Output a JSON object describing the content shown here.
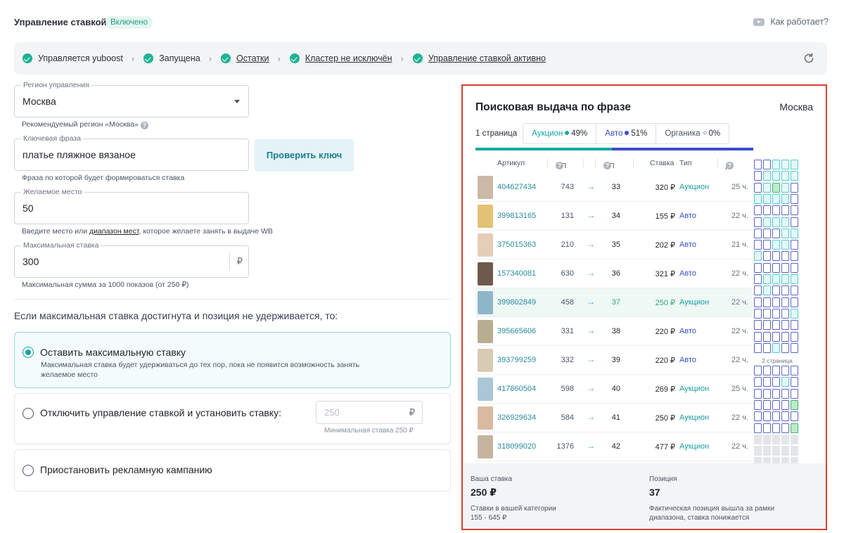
{
  "header": {
    "title": "Управление ставкой:",
    "status_badge": "Включено",
    "how_it_works": "Как работает?"
  },
  "steps": [
    {
      "label": "Управляется yuboost",
      "link": false
    },
    {
      "label": "Запущена",
      "link": false
    },
    {
      "label": "Остатки",
      "link": true
    },
    {
      "label": "Кластер не исключён",
      "link": true
    },
    {
      "label": "Управление ставкой активно",
      "link": true
    }
  ],
  "form": {
    "region": {
      "label": "Регион управления",
      "value": "Москва",
      "help": "Рекомендуемый регион «Москва»"
    },
    "keyword": {
      "label": "Ключевая фраза",
      "value": "платье пляжное вязаное",
      "help": "Фраза по которой будет формироваться ставка"
    },
    "check_button": "Проверить ключ",
    "place": {
      "label": "Желаемое место",
      "value": "50",
      "help_before": "Введите место или ",
      "help_link": "диапазон мест",
      "help_after": ", которое желаете занять в выдаче WB"
    },
    "max_bid": {
      "label": "Максимальная ставка",
      "value": "300",
      "currency": "₽",
      "help": "Максимальная сумма за 1000 показов (от 250 ₽)"
    },
    "question": "Если максимальная ставка достигнута и позиция не удерживается, то:",
    "options": {
      "keep": {
        "title": "Оставить максимальную ставку",
        "description": "Максимальная ставка будет удерживаться до тех пор, пока не появится возможность занять желаемое место",
        "selected": true
      },
      "disable": {
        "title": "Отключить управление ставкой и установить ставку:",
        "placeholder": "250",
        "currency": "₽",
        "note": "Минимальная ставка 250 ₽",
        "selected": false
      },
      "pause": {
        "title": "Приостановить рекламную кампанию",
        "selected": false
      }
    }
  },
  "panel": {
    "title": "Поисковая выдача по фразе",
    "city": "Москва",
    "page_label": "1 страница",
    "tabs": [
      {
        "name": "Аукцион",
        "percent": "49%",
        "color": "#17a8a0"
      },
      {
        "name": "Авто",
        "percent": "51%",
        "color": "#3a4bc9"
      },
      {
        "name": "Органика",
        "percent": "0%",
        "color": "#d5d8dc"
      }
    ],
    "progress": {
      "auction": 0.49,
      "auto": 0.51
    },
    "columns": {
      "article": "Артикул",
      "np": "НП",
      "fp": "ФП",
      "bid": "Ставка",
      "type": "Тип",
      "days": "Д"
    },
    "rows": [
      {
        "article": "404627434",
        "np": "743",
        "fp": "33",
        "bid": "320 ₽",
        "type": "Аукцион",
        "days": "25 ч.",
        "highlight": false,
        "thumb": "#cbb8a6"
      },
      {
        "article": "399813165",
        "np": "131",
        "fp": "34",
        "bid": "155 ₽",
        "type": "Авто",
        "days": "22 ч.",
        "highlight": false,
        "thumb": "#e3c276"
      },
      {
        "article": "375015363",
        "np": "210",
        "fp": "35",
        "bid": "202 ₽",
        "type": "Авто",
        "days": "21 ч.",
        "highlight": false,
        "thumb": "#e6cdb8"
      },
      {
        "article": "157340081",
        "np": "630",
        "fp": "36",
        "bid": "321 ₽",
        "type": "Авто",
        "days": "22 ч.",
        "highlight": false,
        "thumb": "#6e5a4c"
      },
      {
        "article": "399802849",
        "np": "458",
        "fp": "37",
        "bid": "250 ₽",
        "type": "Аукцион",
        "days": "22 ч.",
        "highlight": true,
        "thumb": "#8fb6c8"
      },
      {
        "article": "395665606",
        "np": "331",
        "fp": "38",
        "bid": "220 ₽",
        "type": "Авто",
        "days": "22 ч.",
        "highlight": false,
        "thumb": "#b9ad8f"
      },
      {
        "article": "393799259",
        "np": "332",
        "fp": "39",
        "bid": "220 ₽",
        "type": "Авто",
        "days": "22 ч.",
        "highlight": false,
        "thumb": "#d8cbb4"
      },
      {
        "article": "417860504",
        "np": "598",
        "fp": "40",
        "bid": "269 ₽",
        "type": "Аукцион",
        "days": "25 ч.",
        "highlight": false,
        "thumb": "#a9c7d6"
      },
      {
        "article": "326929634",
        "np": "584",
        "fp": "41",
        "bid": "250 ₽",
        "type": "Аукцион",
        "days": "22 ч.",
        "highlight": false,
        "thumb": "#d9b9a0"
      },
      {
        "article": "318099020",
        "np": "1376",
        "fp": "42",
        "bid": "477 ₽",
        "type": "Аукцион",
        "days": "22 ч.",
        "highlight": false,
        "thumb": "#c6b49e"
      }
    ],
    "minimap": {
      "page2_label": "2 страница",
      "page1": [
        "BBTTT",
        "BTTTT",
        "BTGTB",
        "TTTTB",
        "BBBBB",
        "BTTTB",
        "BBBTT",
        "BBTTB",
        "TBBBB",
        "BBBBB",
        "BTTTT",
        "BTBBB",
        "BBBBB",
        "BBBBT",
        "BBBBB",
        "BBBBB",
        "BBTBB"
      ],
      "page2": [
        "BBBBB",
        "BBBTB",
        "BBBBB",
        "BBBBG",
        "BBBBB",
        "BBBBG",
        "EEEEE",
        "EEEEE",
        "EEEEE"
      ]
    },
    "footer": {
      "your_bid_label": "Ваша ставка",
      "your_bid_value": "250 ₽",
      "category_bids_label": "Ставки в вашей категории",
      "category_bids_range": "155 - 645 ₽",
      "position_label": "Позиция",
      "position_value": "37",
      "position_note": "Фактическая позиция вышла за рамки диапазона, ставка понижается"
    }
  }
}
